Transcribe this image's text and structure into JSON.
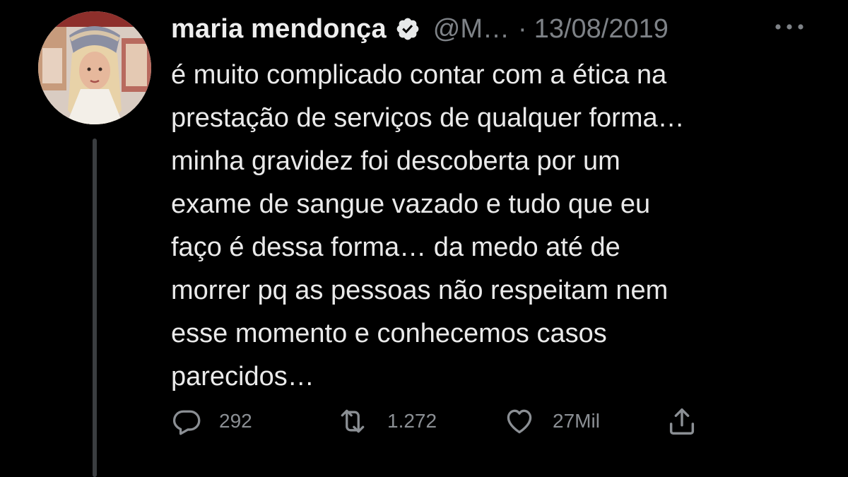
{
  "tweet": {
    "author": {
      "display_name": "maria mendonça",
      "handle": "@M…",
      "verified_icon": "verified-badge-icon"
    },
    "separator": "·",
    "date": "13/08/2019",
    "more_icon": "more-options-icon",
    "text_lines": [
      "é muito complicado contar com a ética na",
      "prestação de serviços de qualquer forma…",
      "minha gravidez foi descoberta por um",
      "exame de sangue vazado e tudo que eu",
      "faço é dessa forma… da medo até de",
      "morrer pq as pessoas não respeitam nem",
      "esse momento e conhecemos casos",
      "parecidos…"
    ],
    "actions": {
      "reply": {
        "icon": "reply-icon",
        "count": "292"
      },
      "retweet": {
        "icon": "retweet-icon",
        "count": "1.272"
      },
      "like": {
        "icon": "heart-icon",
        "count": "27Mil"
      },
      "share": {
        "icon": "share-icon"
      }
    }
  },
  "colors": {
    "background": "#000000",
    "primary_text": "#e7e9ea",
    "secondary_text": "#7e8287",
    "action_icons": "#8b8f94",
    "thread_line": "#3a3d40"
  }
}
